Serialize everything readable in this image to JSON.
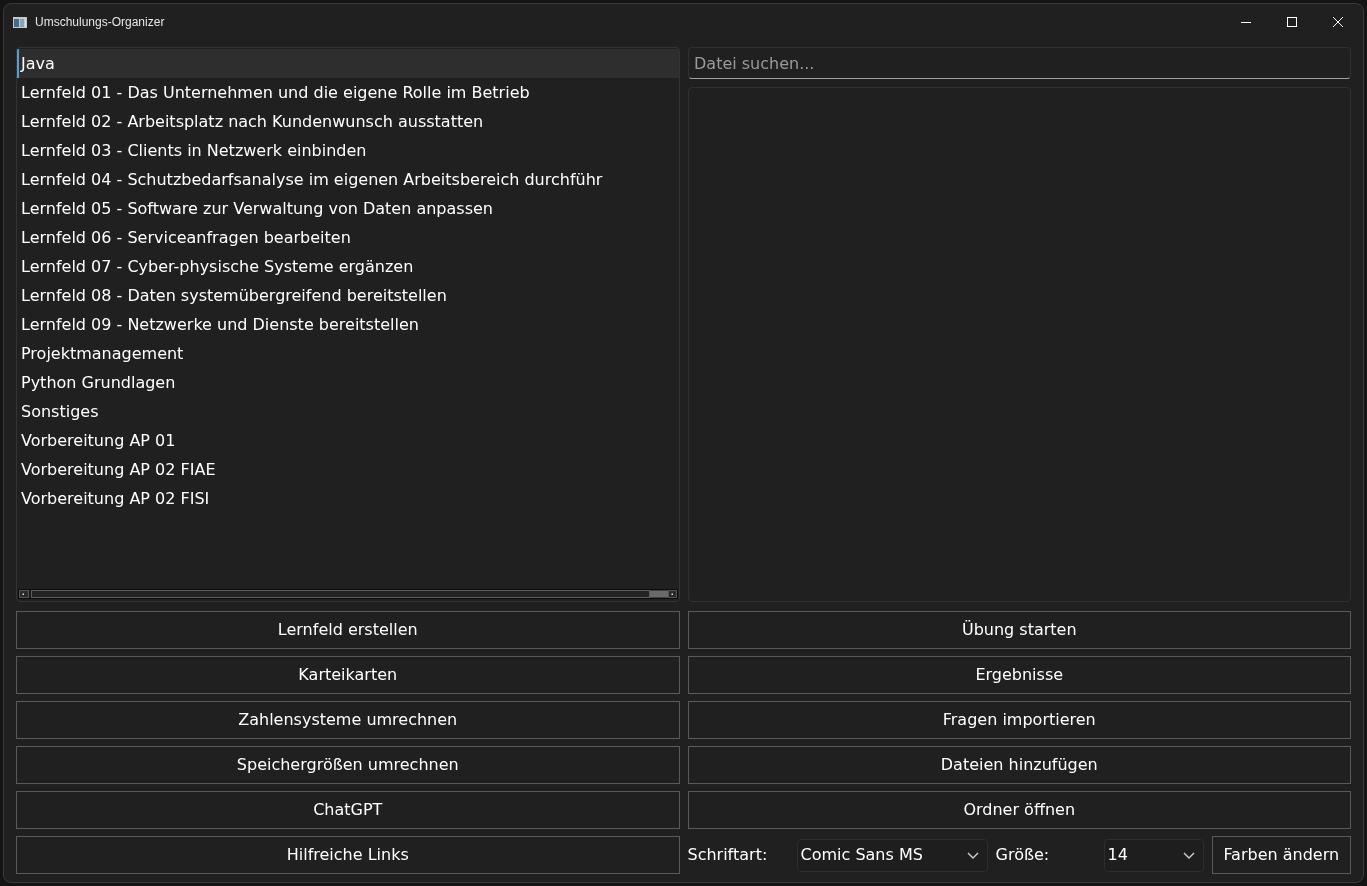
{
  "window": {
    "title": "Umschulungs-Organizer"
  },
  "folder_list": {
    "items": [
      {
        "label": "Java",
        "selected": true
      },
      {
        "label": "Lernfeld 01 - Das Unternehmen und die eigene Rolle im Betrieb",
        "selected": false
      },
      {
        "label": "Lernfeld 02 - Arbeitsplatz nach Kundenwunsch ausstatten",
        "selected": false
      },
      {
        "label": "Lernfeld 03 - Clients in Netzwerk einbinden",
        "selected": false
      },
      {
        "label": "Lernfeld 04 - Schutzbedarfsanalyse im eigenen Arbeitsbereich durchführ",
        "selected": false
      },
      {
        "label": "Lernfeld 05 - Software zur Verwaltung von Daten anpassen",
        "selected": false
      },
      {
        "label": "Lernfeld 06 - Serviceanfragen bearbeiten",
        "selected": false
      },
      {
        "label": "Lernfeld 07 - Cyber-physische Systeme ergänzen",
        "selected": false
      },
      {
        "label": "Lernfeld 08 - Daten systemübergreifend bereitstellen",
        "selected": false
      },
      {
        "label": "Lernfeld 09 - Netzwerke und Dienste bereitstellen",
        "selected": false
      },
      {
        "label": "Projektmanagement",
        "selected": false
      },
      {
        "label": "Python Grundlagen",
        "selected": false
      },
      {
        "label": "Sonstiges",
        "selected": false
      },
      {
        "label": "Vorbereitung AP 01",
        "selected": false
      },
      {
        "label": "Vorbereitung AP 02 FIAE",
        "selected": false
      },
      {
        "label": "Vorbereitung AP 02 FISI",
        "selected": false
      }
    ]
  },
  "search": {
    "placeholder": "Datei suchen..."
  },
  "buttons_left": [
    "Lernfeld erstellen",
    "Karteikarten",
    "Zahlensysteme umrechnen",
    "Speichergrößen umrechnen",
    "ChatGPT",
    "Hilfreiche Links"
  ],
  "buttons_right": [
    "Übung starten",
    "Ergebnisse",
    "Fragen importieren",
    "Dateien hinzufügen",
    "Ordner öffnen"
  ],
  "font_settings": {
    "font_label": "Schriftart:",
    "font_value": "Comic Sans MS",
    "size_label": "Größe:",
    "size_value": "14",
    "colors_button": "Farben ändern"
  }
}
